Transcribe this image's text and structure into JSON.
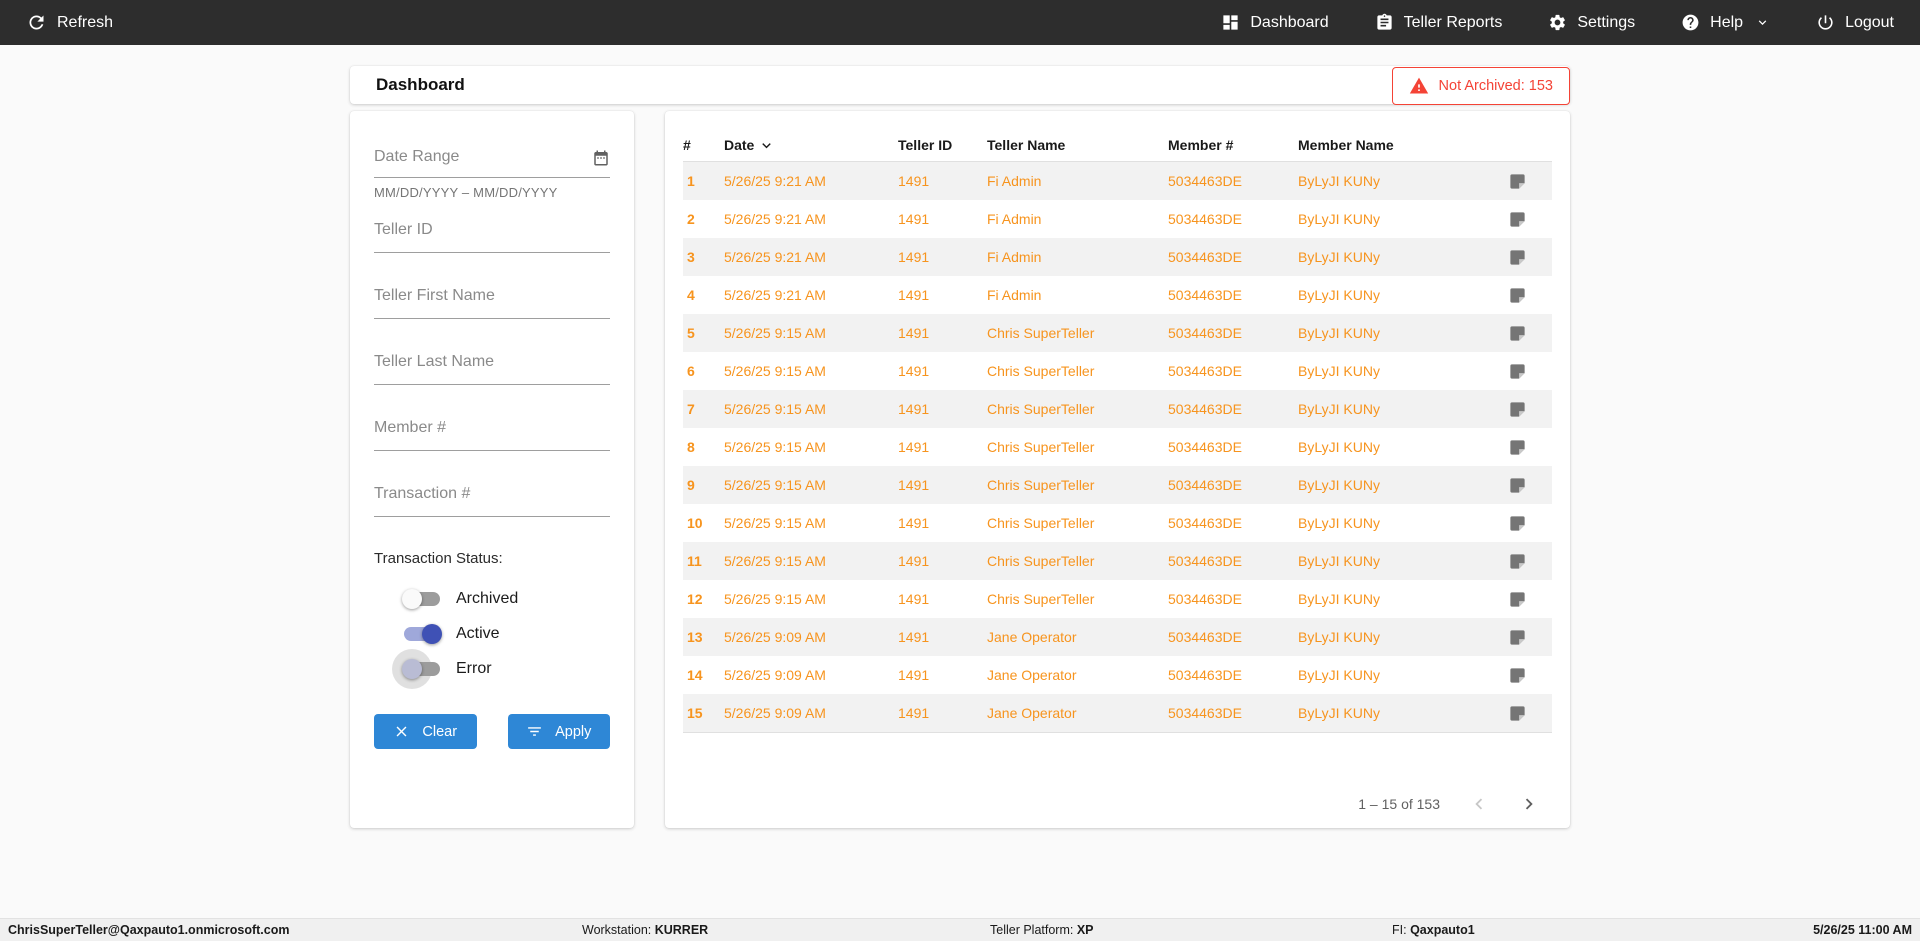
{
  "colors": {
    "nav_bg": "#2d2d2d",
    "accent_orange": "#f7941e",
    "accent_blue": "#2e87d6",
    "alert_red": "#f44336",
    "toggle_on_indigo": "#3f51b5"
  },
  "navbar": {
    "refresh_label": "Refresh",
    "items": [
      {
        "label": "Dashboard",
        "icon": "dashboard-icon"
      },
      {
        "label": "Teller Reports",
        "icon": "clipboard-icon"
      },
      {
        "label": "Settings",
        "icon": "gear-icon"
      },
      {
        "label": "Help",
        "icon": "help-icon",
        "has_chevron": true
      },
      {
        "label": "Logout",
        "icon": "power-icon"
      }
    ]
  },
  "page": {
    "title": "Dashboard",
    "alert": {
      "label": "Not Archived: 153"
    }
  },
  "filters": {
    "date_range": {
      "label": "Date Range",
      "value": "",
      "helper": "MM/DD/YYYY – MM/DD/YYYY"
    },
    "fields": [
      {
        "label": "Teller ID",
        "value": ""
      },
      {
        "label": "Teller First Name",
        "value": ""
      },
      {
        "label": "Teller Last Name",
        "value": ""
      },
      {
        "label": "Member #",
        "value": ""
      },
      {
        "label": "Transaction #",
        "value": ""
      }
    ],
    "status": {
      "label": "Transaction Status:",
      "toggles": [
        {
          "label": "Archived",
          "on": false,
          "focused": false
        },
        {
          "label": "Active",
          "on": true,
          "focused": false
        },
        {
          "label": "Error",
          "on": false,
          "focused": true
        }
      ]
    },
    "clear_label": "Clear",
    "apply_label": "Apply"
  },
  "table": {
    "columns": [
      "#",
      "Date",
      "Teller ID",
      "Teller Name",
      "Member #",
      "Member Name"
    ],
    "sorted_column": "Date",
    "rows": [
      {
        "num": "1",
        "date": "5/26/25 9:21 AM",
        "teller_id": "1491",
        "teller_name": "Fi Admin",
        "member_num": "5034463DE",
        "member_name": "ByLyJI KUNy"
      },
      {
        "num": "2",
        "date": "5/26/25 9:21 AM",
        "teller_id": "1491",
        "teller_name": "Fi Admin",
        "member_num": "5034463DE",
        "member_name": "ByLyJI KUNy"
      },
      {
        "num": "3",
        "date": "5/26/25 9:21 AM",
        "teller_id": "1491",
        "teller_name": "Fi Admin",
        "member_num": "5034463DE",
        "member_name": "ByLyJI KUNy"
      },
      {
        "num": "4",
        "date": "5/26/25 9:21 AM",
        "teller_id": "1491",
        "teller_name": "Fi Admin",
        "member_num": "5034463DE",
        "member_name": "ByLyJI KUNy"
      },
      {
        "num": "5",
        "date": "5/26/25 9:15 AM",
        "teller_id": "1491",
        "teller_name": "Chris SuperTeller",
        "member_num": "5034463DE",
        "member_name": "ByLyJI KUNy"
      },
      {
        "num": "6",
        "date": "5/26/25 9:15 AM",
        "teller_id": "1491",
        "teller_name": "Chris SuperTeller",
        "member_num": "5034463DE",
        "member_name": "ByLyJI KUNy"
      },
      {
        "num": "7",
        "date": "5/26/25 9:15 AM",
        "teller_id": "1491",
        "teller_name": "Chris SuperTeller",
        "member_num": "5034463DE",
        "member_name": "ByLyJI KUNy"
      },
      {
        "num": "8",
        "date": "5/26/25 9:15 AM",
        "teller_id": "1491",
        "teller_name": "Chris SuperTeller",
        "member_num": "5034463DE",
        "member_name": "ByLyJI KUNy"
      },
      {
        "num": "9",
        "date": "5/26/25 9:15 AM",
        "teller_id": "1491",
        "teller_name": "Chris SuperTeller",
        "member_num": "5034463DE",
        "member_name": "ByLyJI KUNy"
      },
      {
        "num": "10",
        "date": "5/26/25 9:15 AM",
        "teller_id": "1491",
        "teller_name": "Chris SuperTeller",
        "member_num": "5034463DE",
        "member_name": "ByLyJI KUNy"
      },
      {
        "num": "11",
        "date": "5/26/25 9:15 AM",
        "teller_id": "1491",
        "teller_name": "Chris SuperTeller",
        "member_num": "5034463DE",
        "member_name": "ByLyJI KUNy"
      },
      {
        "num": "12",
        "date": "5/26/25 9:15 AM",
        "teller_id": "1491",
        "teller_name": "Chris SuperTeller",
        "member_num": "5034463DE",
        "member_name": "ByLyJI KUNy"
      },
      {
        "num": "13",
        "date": "5/26/25 9:09 AM",
        "teller_id": "1491",
        "teller_name": "Jane Operator",
        "member_num": "5034463DE",
        "member_name": "ByLyJI KUNy"
      },
      {
        "num": "14",
        "date": "5/26/25 9:09 AM",
        "teller_id": "1491",
        "teller_name": "Jane Operator",
        "member_num": "5034463DE",
        "member_name": "ByLyJI KUNy"
      },
      {
        "num": "15",
        "date": "5/26/25 9:09 AM",
        "teller_id": "1491",
        "teller_name": "Jane Operator",
        "member_num": "5034463DE",
        "member_name": "ByLyJI KUNy"
      }
    ],
    "pagination": {
      "range_label": "1 – 15 of 153",
      "prev_enabled": false,
      "next_enabled": true
    }
  },
  "statusbar": {
    "user": "ChrisSuperTeller@Qaxpauto1.onmicrosoft.com",
    "workstation_label": "Workstation: ",
    "workstation": "KURRER",
    "platform_label": "Teller Platform: ",
    "platform": "XP",
    "fi_label": "FI: ",
    "fi": "Qaxpauto1",
    "datetime": "5/26/25 11:00 AM"
  }
}
